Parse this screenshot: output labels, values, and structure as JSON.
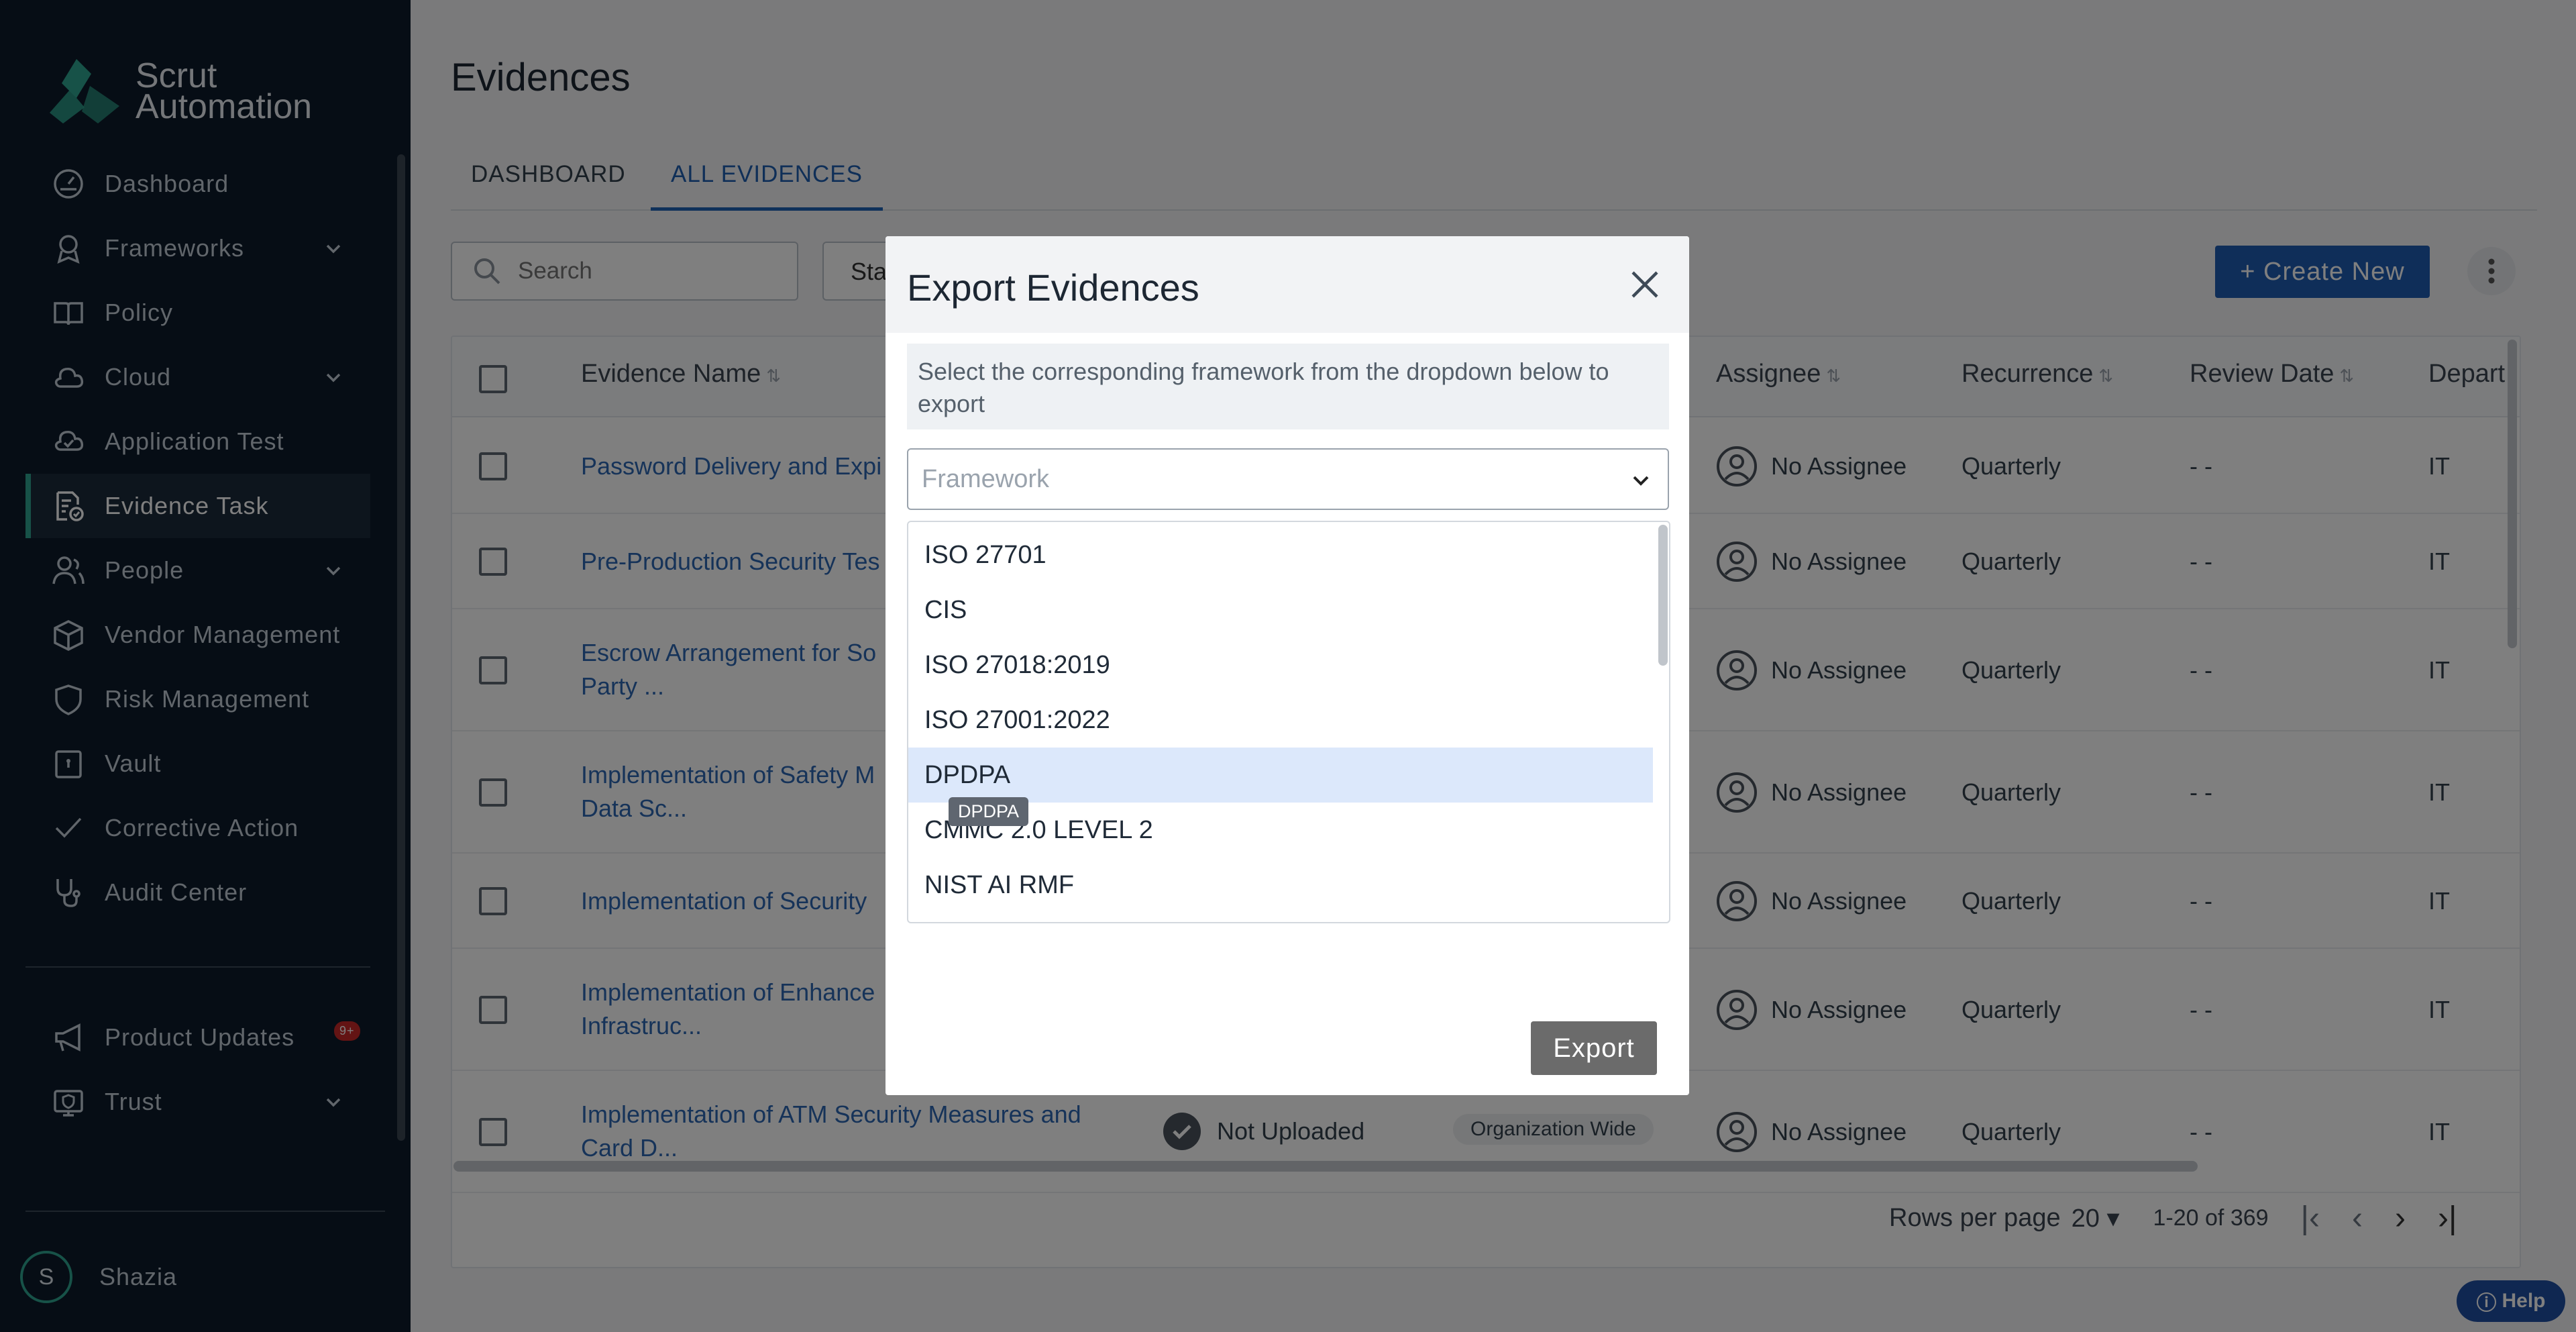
{
  "app": {
    "logo_line1": "Scrut",
    "logo_line2": "Automation"
  },
  "sidebar": {
    "items": [
      {
        "label": "Dashboard",
        "icon": "dashboard-icon"
      },
      {
        "label": "Frameworks",
        "icon": "frameworks-icon",
        "expandable": true
      },
      {
        "label": "Policy",
        "icon": "book-icon"
      },
      {
        "label": "Cloud",
        "icon": "cloud-icon",
        "expandable": true
      },
      {
        "label": "Application Test",
        "icon": "cloud-check-icon"
      },
      {
        "label": "Evidence Task",
        "icon": "evidence-icon",
        "active": true
      },
      {
        "label": "People",
        "icon": "people-icon",
        "expandable": true
      },
      {
        "label": "Vendor Management",
        "icon": "box-icon"
      },
      {
        "label": "Risk Management",
        "icon": "shield-icon"
      },
      {
        "label": "Vault",
        "icon": "vault-icon"
      },
      {
        "label": "Corrective Action",
        "icon": "check-icon"
      },
      {
        "label": "Audit Center",
        "icon": "stethoscope-icon"
      }
    ],
    "bottom_items": [
      {
        "label": "Product Updates",
        "icon": "megaphone-icon",
        "badge": "9+"
      },
      {
        "label": "Trust",
        "icon": "trust-icon",
        "expandable": true
      }
    ],
    "user": {
      "initial": "S",
      "name": "Shazia"
    }
  },
  "main": {
    "title": "Evidences",
    "tabs": [
      {
        "label": "DASHBOARD"
      },
      {
        "label": "ALL EVIDENCES",
        "active": true
      }
    ],
    "search_placeholder": "Search",
    "status_filter": "Sta",
    "create_label": "+ Create New",
    "columns": {
      "evidence_name": "Evidence Name",
      "assignee": "Assignee",
      "recurrence": "Recurrence",
      "review_date": "Review Date",
      "department": "Depart"
    },
    "rows": [
      {
        "name": "Password Delivery and Expi",
        "assignee": "No Assignee",
        "recurrence": "Quarterly",
        "review": "- -",
        "dept": "IT"
      },
      {
        "name": "Pre-Production Security Tes",
        "assignee": "No Assignee",
        "recurrence": "Quarterly",
        "review": "- -",
        "dept": "IT"
      },
      {
        "name": "Escrow Arrangement for So",
        "name2": "Party ...",
        "assignee": "No Assignee",
        "recurrence": "Quarterly",
        "review": "- -",
        "dept": "IT"
      },
      {
        "name": "Implementation of Safety M",
        "name2": "Data Sc...",
        "assignee": "No Assignee",
        "recurrence": "Quarterly",
        "review": "- -",
        "dept": "IT"
      },
      {
        "name": "Implementation of Security",
        "assignee": "No Assignee",
        "recurrence": "Quarterly",
        "review": "- -",
        "dept": "IT"
      },
      {
        "name": "Implementation of Enhance",
        "name2": "Infrastruc...",
        "assignee": "No Assignee",
        "recurrence": "Quarterly",
        "review": "- -",
        "dept": "IT"
      },
      {
        "name": "Implementation of ATM Security Measures and",
        "name2": "Card D...",
        "status": "Not Uploaded",
        "scope": "Organization Wide",
        "assignee": "No Assignee",
        "recurrence": "Quarterly",
        "review": "- -",
        "dept": "IT"
      }
    ],
    "pagination": {
      "rows_per_page_label": "Rows per page",
      "rows_per_page": "20",
      "range": "1-20 of 369"
    },
    "help_label": "Help"
  },
  "modal": {
    "title": "Export Evidences",
    "info": "Select the corresponding framework from the dropdown below to export",
    "framework_placeholder": "Framework",
    "options": [
      "ISO 27701",
      "CIS",
      "ISO 27018:2019",
      "ISO 27001:2022",
      "DPDPA",
      "CMMC 2.0 LEVEL 2",
      "NIST AI RMF"
    ],
    "highlighted_option": "DPDPA",
    "tooltip": "DPDPA",
    "export_label": "Export"
  },
  "colors": {
    "sidebar_bg": "#0c1b2a",
    "accent": "#2fa590",
    "primary": "#1f5cb2",
    "link": "#2d67b3"
  }
}
